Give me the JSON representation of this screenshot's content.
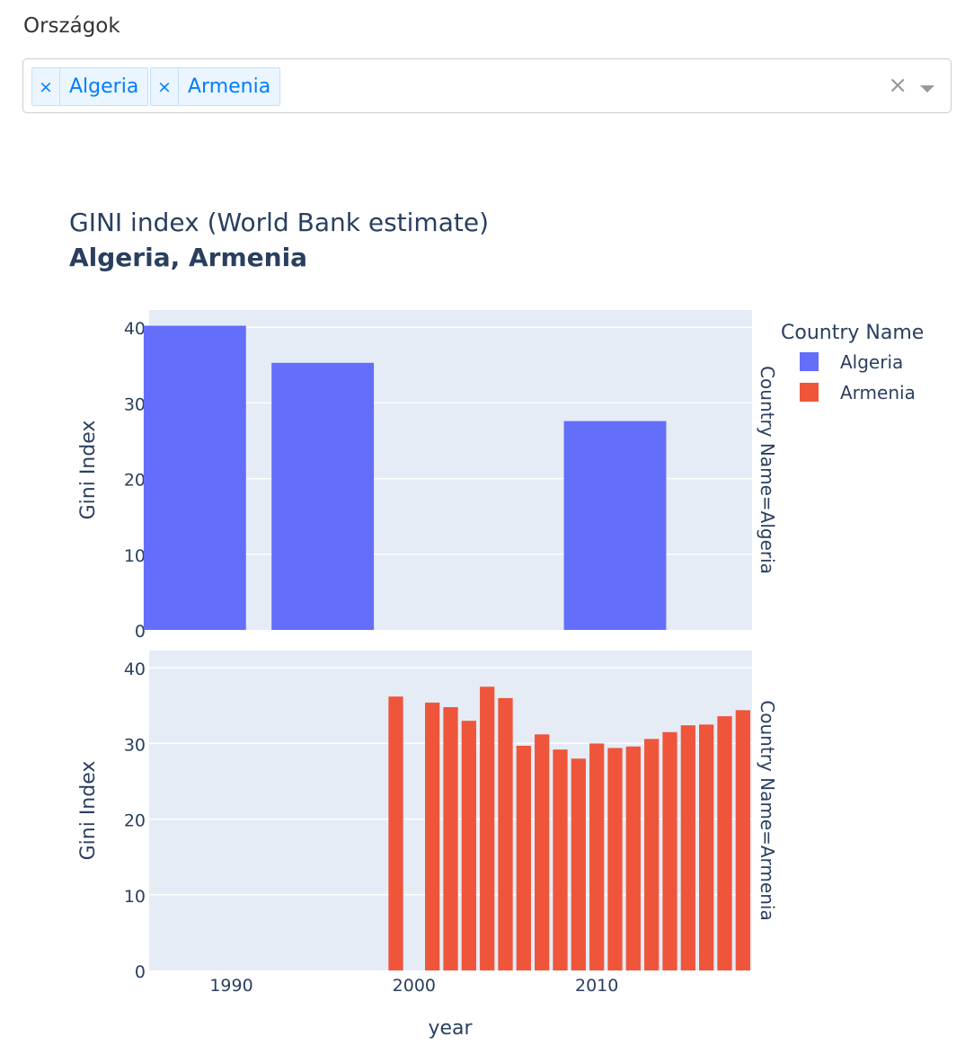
{
  "dropdown": {
    "label": "Országok",
    "selected": [
      "Algeria",
      "Armenia"
    ],
    "remove_glyph": "×",
    "clear_glyph": "×"
  },
  "chart_data": {
    "type": "bar",
    "title": "GINI index (World Bank estimate)",
    "subtitle": "Algeria, Armenia",
    "xlabel": "year",
    "ylabel": "Gini Index",
    "xlim": [
      1985.5,
      2018.5
    ],
    "ylim": [
      0,
      42
    ],
    "x_ticks": [
      1990,
      2000,
      2010
    ],
    "y_ticks": [
      0,
      10,
      20,
      30,
      40
    ],
    "grid": true,
    "legend": {
      "title": "Country Name",
      "placement": "top-right"
    },
    "facets": [
      {
        "label": "Country Name=Algeria",
        "series": {
          "name": "Algeria",
          "color": "#636efa",
          "x": [
            1988,
            1995,
            2011
          ],
          "y": [
            40.2,
            35.3,
            27.6
          ],
          "bar_width_years": 5.6
        }
      },
      {
        "label": "Country Name=Armenia",
        "series": {
          "name": "Armenia",
          "color": "#ef553b",
          "x": [
            1999,
            2001,
            2002,
            2003,
            2004,
            2005,
            2006,
            2007,
            2008,
            2009,
            2010,
            2011,
            2012,
            2013,
            2014,
            2015,
            2016,
            2017,
            2018
          ],
          "y": [
            36.2,
            35.4,
            34.8,
            33.0,
            37.5,
            36.0,
            29.7,
            31.2,
            29.2,
            28.0,
            30.0,
            29.4,
            29.6,
            30.6,
            31.5,
            32.4,
            32.5,
            33.6,
            34.4
          ],
          "bar_width_years": 0.8
        }
      }
    ]
  }
}
